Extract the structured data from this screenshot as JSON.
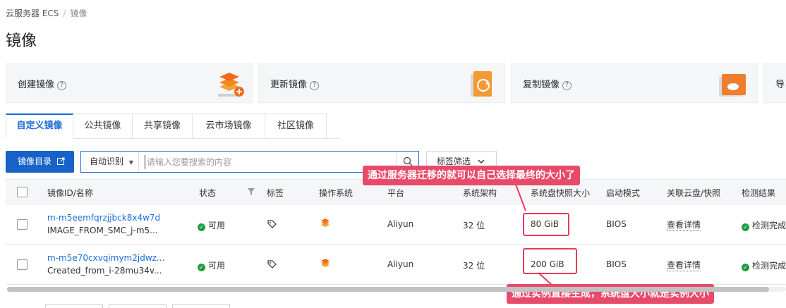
{
  "breadcrumb": {
    "root": "云服务器 ECS",
    "separator": "/",
    "current": "镜像"
  },
  "page_title": "镜像",
  "cards": [
    {
      "label": "创建镜像",
      "icon": "create-image-icon"
    },
    {
      "label": "更新镜像",
      "icon": "update-image-icon"
    },
    {
      "label": "复制镜像",
      "icon": "copy-image-icon"
    },
    {
      "label": "导"
    }
  ],
  "tabs": [
    "自定义镜像",
    "公共镜像",
    "共享镜像",
    "云市场镜像",
    "社区镜像"
  ],
  "toolbar": {
    "catalog_label": "镜像目录",
    "search_type": "自动识别",
    "search_placeholder": "请输入您要搜索的内容",
    "tag_filter": "标签筛选"
  },
  "columns": [
    "镜像ID/名称",
    "状态",
    "标签",
    "操作系统",
    "平台",
    "系统架构",
    "系统盘快照大小",
    "启动模式",
    "关联云盘/快照",
    "检测结果"
  ],
  "rows": [
    {
      "id": "m-m5eemfqrzjjbck8x4w7d",
      "name": "IMAGE_FROM_SMC_j-m5...",
      "status": "可用",
      "platform": "Aliyun",
      "arch": "32 位",
      "size": "80 GiB",
      "boot": "BIOS",
      "detail": "查看详情",
      "check": "检测完成"
    },
    {
      "id": "m-m5e70cxvqimym2jdwz...",
      "name": "Created_from_i-28mu34v...",
      "status": "可用",
      "platform": "Aliyun",
      "arch": "32 位",
      "size": "200 GiB",
      "boot": "BIOS",
      "detail": "查看详情",
      "check": "检测完成"
    }
  ],
  "annotations": {
    "top": "通过服务器迁移的就可以自己选择最终的大小了",
    "bottom": "通过实例直接生成，系统盘大小就是实例大小"
  },
  "colors": {
    "accent": "#1a6cd6",
    "annotation": "#e84a6a",
    "ok": "#1e9e3e"
  }
}
